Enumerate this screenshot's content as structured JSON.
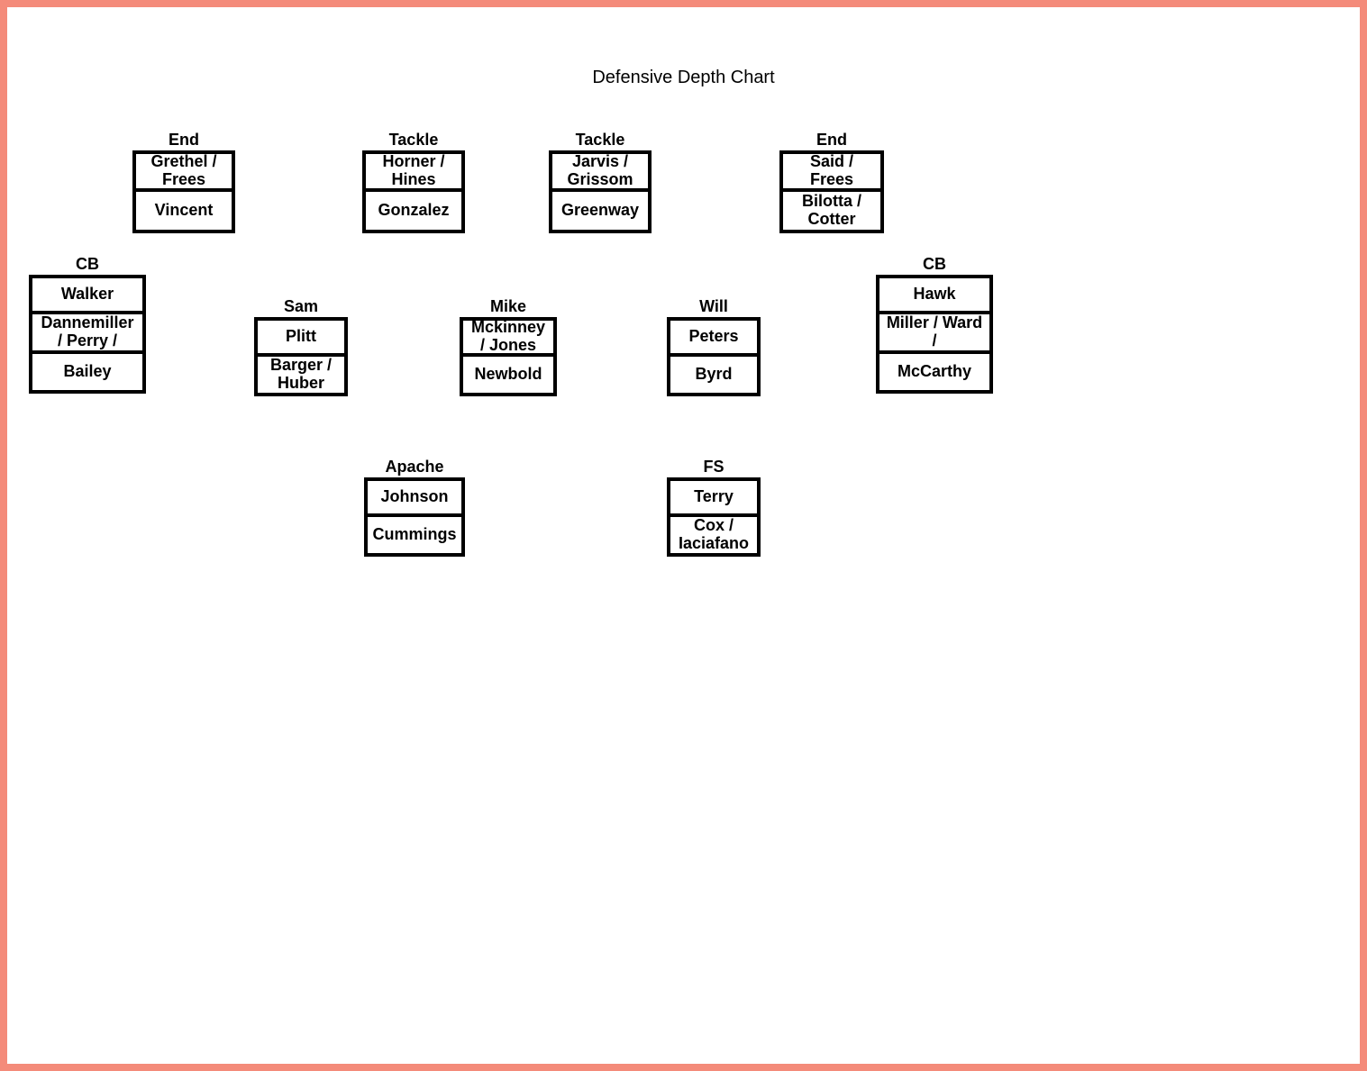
{
  "title": "Defensive Depth Chart",
  "positions": {
    "end_left": {
      "label": "End",
      "starter": "Grethel / Frees",
      "backup": "Vincent"
    },
    "tackle_left": {
      "label": "Tackle",
      "starter": "Horner / Hines",
      "backup": "Gonzalez"
    },
    "tackle_right": {
      "label": "Tackle",
      "starter": "Jarvis / Grissom",
      "backup": "Greenway"
    },
    "end_right": {
      "label": "End",
      "starter": "Said / Frees",
      "backup": "Bilotta / Cotter"
    },
    "cb_left": {
      "label": "CB",
      "starter": "Walker",
      "backup": "Dannemiller / Perry /",
      "third": "Bailey"
    },
    "sam": {
      "label": "Sam",
      "starter": "Plitt",
      "backup": "Barger / Huber"
    },
    "mike": {
      "label": "Mike",
      "starter": "Mckinney / Jones",
      "backup": "Newbold"
    },
    "will": {
      "label": "Will",
      "starter": "Peters",
      "backup": "Byrd"
    },
    "cb_right": {
      "label": "CB",
      "starter": "Hawk",
      "backup": "Miller / Ward /",
      "third": "McCarthy"
    },
    "apache": {
      "label": "Apache",
      "starter": "Johnson",
      "backup": "Cummings"
    },
    "fs": {
      "label": "FS",
      "starter": "Terry",
      "backup": "Cox / Iaciafano"
    }
  }
}
